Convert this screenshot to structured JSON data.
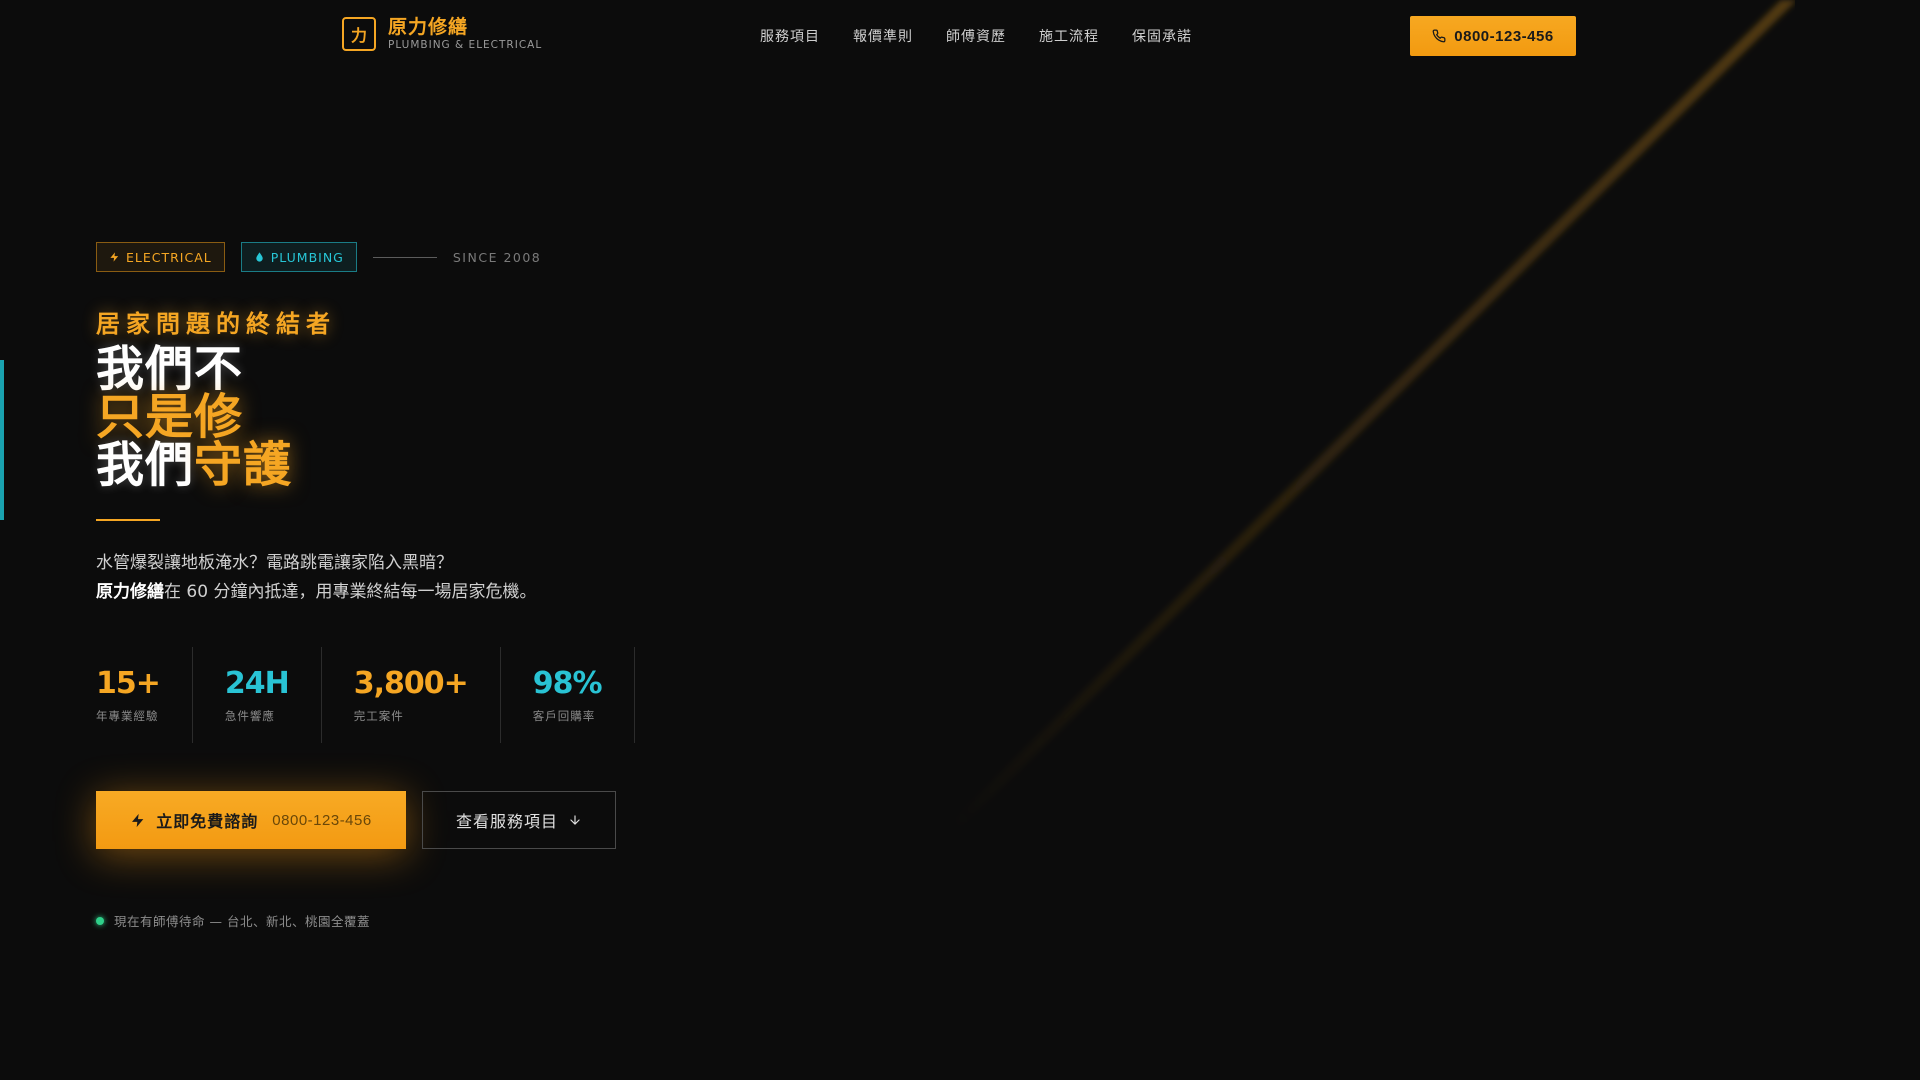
{
  "brand": {
    "mark": "力",
    "name": "原力修繕",
    "sub": "PLUMBING & ELECTRICAL"
  },
  "nav": {
    "links": [
      "服務項目",
      "報價準則",
      "師傅資歷",
      "施工流程",
      "保固承諾"
    ],
    "cta_phone": "0800-123-456"
  },
  "hero": {
    "tags": {
      "electrical": "ELECTRICAL",
      "plumbing": "PLUMBING",
      "since": "SINCE 2008"
    },
    "eyebrow": "居家問題的終結者",
    "headline": {
      "line1": "我們不",
      "line2": "只是修",
      "line3_white": "我們",
      "line3_orange": "守護"
    },
    "desc": {
      "line1": "水管爆裂讓地板淹水？電路跳電讓家陷入黑暗？",
      "brand_bold": "原力修繕",
      "line2_rest": "在 60 分鐘內抵達，用專業終結每一場居家危機。"
    },
    "stats": [
      {
        "value": "15+",
        "label": "年專業經驗",
        "color": "orange"
      },
      {
        "value": "24H",
        "label": "急件響應",
        "color": "cyan"
      },
      {
        "value": "3,800+",
        "label": "完工案件",
        "color": "orange"
      },
      {
        "value": "98%",
        "label": "客戶回購率",
        "color": "cyan"
      }
    ],
    "cta_primary": {
      "label": "立即免費諮詢",
      "phone": "0800-123-456"
    },
    "cta_secondary": {
      "label": "查看服務項目"
    },
    "status": "現在有師傅待命 — 台北、新北、桃園全覆蓋"
  },
  "colors": {
    "accent": "#f5a623",
    "cyan": "#29c3d4",
    "status_green": "#2fd08a",
    "background": "#0c0c0c"
  }
}
